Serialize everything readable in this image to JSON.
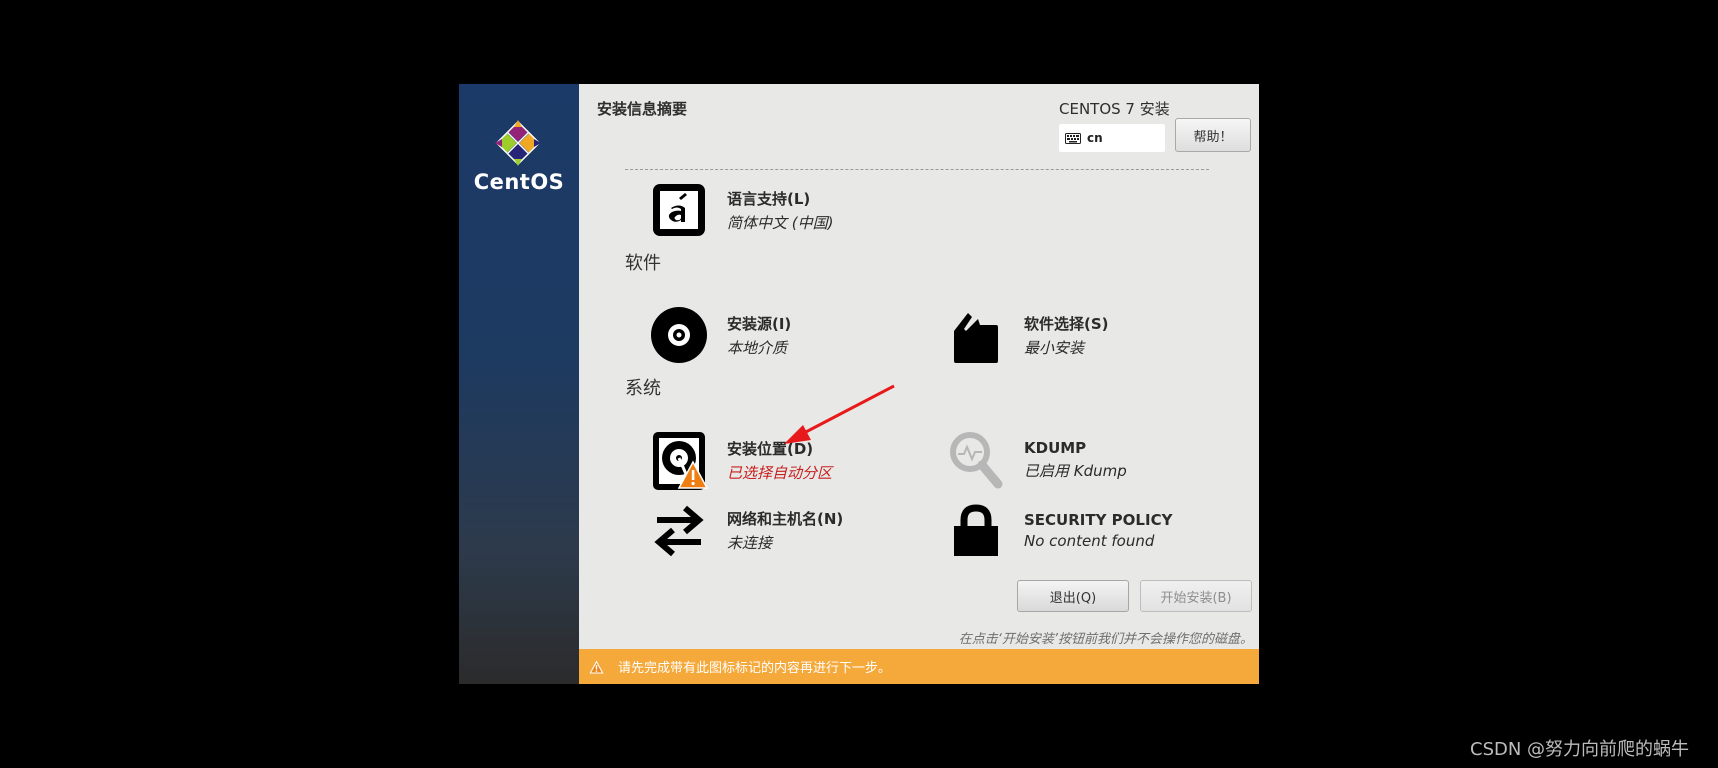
{
  "sidebar": {
    "brand": "CentOS"
  },
  "header": {
    "title": "安装信息摘要",
    "product": "CENTOS 7 安装",
    "keyboard_layout": "cn",
    "help_label": "帮助！"
  },
  "localization": {
    "language": {
      "title": "语言支持(L)",
      "status": "简体中文 (中国)",
      "icon": "language-icon"
    }
  },
  "software": {
    "heading": "软件",
    "source": {
      "title": "安装源(I)",
      "status": "本地介质",
      "icon": "disc-icon"
    },
    "selection": {
      "title": "软件选择(S)",
      "status": "最小安装",
      "icon": "package-icon"
    }
  },
  "system": {
    "heading": "系统",
    "destination": {
      "title": "安装位置(D)",
      "status": "已选择自动分区",
      "icon": "harddisk-warning-icon"
    },
    "kdump": {
      "title": "KDUMP",
      "status": "已启用 Kdump",
      "icon": "magnifier-icon"
    },
    "network": {
      "title": "网络和主机名(N)",
      "status": "未连接",
      "icon": "network-arrows-icon"
    },
    "security": {
      "title": "SECURITY POLICY",
      "status": "No content found",
      "icon": "lock-icon"
    }
  },
  "actions": {
    "quit_label": "退出(Q)",
    "begin_label": "开始安装(B)",
    "note": "在点击‘开始安装’按钮前我们并不会操作您的磁盘。"
  },
  "warning_bar": {
    "message": "请先完成带有此图标标记的内容再进行下一步。"
  },
  "watermark": "CSDN @努力向前爬的蜗牛",
  "colors": {
    "warning": "#f6a93b",
    "error_text": "#c81f1f",
    "annotation_arrow": "#e8191a"
  }
}
